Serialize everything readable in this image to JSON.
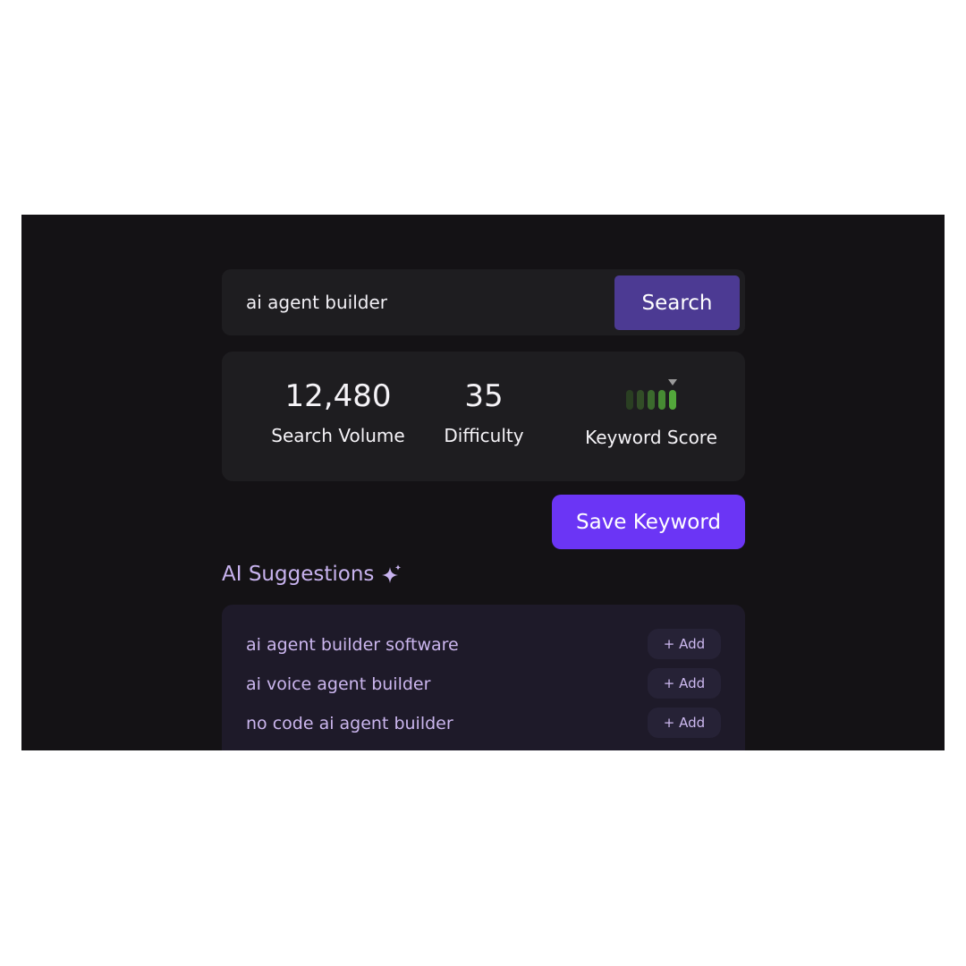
{
  "search": {
    "value": "ai agent builder",
    "button_label": "Search"
  },
  "stats": {
    "search_volume": {
      "value": "12,480",
      "label": "Search Volume"
    },
    "difficulty": {
      "value": "35",
      "label": "Difficulty"
    },
    "keyword_score": {
      "label": "Keyword Score",
      "bars_total": 5,
      "level": 5,
      "bar_colors": [
        "#2a3f22",
        "#324d27",
        "#3b6a2d",
        "#468a33",
        "#53a83b"
      ],
      "marker_color": "#9a9a9a"
    }
  },
  "save_button_label": "Save Keyword",
  "ai_suggestions": {
    "title": "AI Suggestions",
    "icon": "sparkle-icon",
    "items": [
      {
        "text": "ai agent builder software",
        "add_label": "+ Add"
      },
      {
        "text": "ai voice agent builder",
        "add_label": "+ Add"
      },
      {
        "text": "no code ai agent builder",
        "add_label": "+ Add"
      }
    ]
  },
  "colors": {
    "background": "#141215",
    "card": "#1e1d20",
    "search_button": "#4c3a93",
    "save_button": "#6b35f5",
    "suggestion_text": "#cbb6ee"
  }
}
